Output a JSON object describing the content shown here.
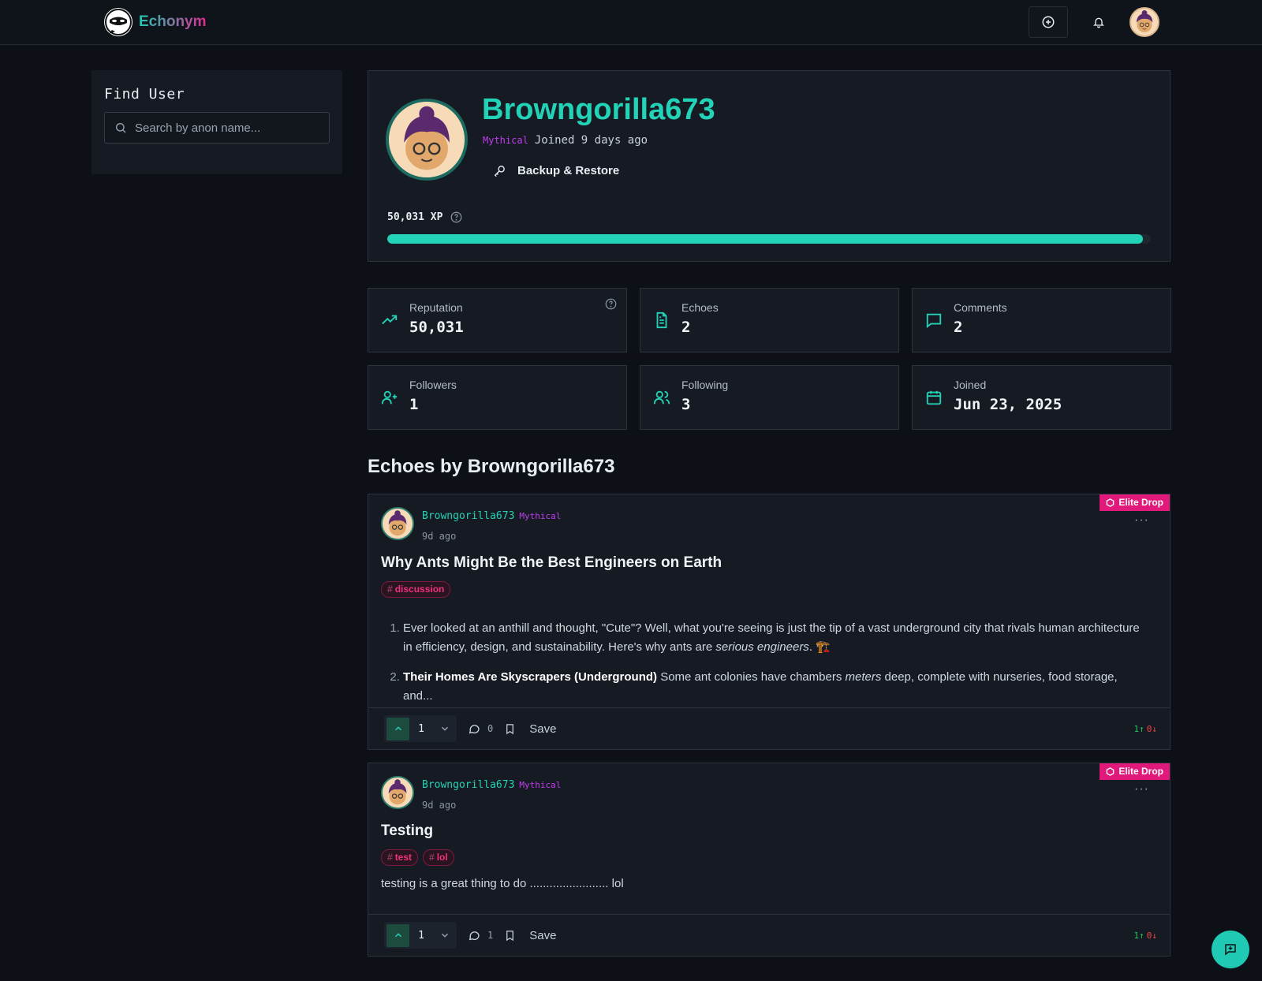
{
  "header": {
    "app_name": "Echonym",
    "icons": [
      "add-circle-icon",
      "bell-icon",
      "user-avatar"
    ]
  },
  "sidebar": {
    "title": "Find User",
    "search_placeholder": "Search by anon name..."
  },
  "profile": {
    "username": "Browngorilla673",
    "tier": "Mythical",
    "joined_text": "Joined 9 days ago",
    "backup_label": "Backup & Restore",
    "xp_label": "50,031 XP",
    "xp_progress_fraction": 0.99
  },
  "stats": [
    {
      "label": "Reputation",
      "value": "50,031",
      "icon": "trending-up-icon"
    },
    {
      "label": "Echoes",
      "value": "2",
      "icon": "document-icon"
    },
    {
      "label": "Comments",
      "value": "2",
      "icon": "message-icon"
    },
    {
      "label": "Followers",
      "value": "1",
      "icon": "user-plus-icon"
    },
    {
      "label": "Following",
      "value": "3",
      "icon": "users-icon"
    },
    {
      "label": "Joined",
      "value": "Jun 23, 2025",
      "icon": "calendar-icon"
    }
  ],
  "section_title": "Echoes by Browngorilla673",
  "posts": [
    {
      "badge": "Elite Drop",
      "author": "Browngorilla673",
      "tier": "Mythical",
      "time": "9d ago",
      "more": "···",
      "title": "Why Ants Might Be the Best Engineers on Earth",
      "tags": [
        "discussion"
      ],
      "body_items": [
        {
          "text_before": "Ever looked at an anthill and thought, \"Cute\"? Well, what you're seeing is just the tip of a vast underground city that rivals human architecture in efficiency, design, and sustainability. Here's why ants are ",
          "emph": "serious engineers",
          "text_after": ". 🏗️"
        },
        {
          "bold": "Their Homes Are Skyscrapers (Underground)",
          "text_before": " Some ant colonies have chambers ",
          "emph": "meters",
          "text_after": " deep, complete with nurseries, food storage, and..."
        }
      ],
      "votes": "1",
      "comments": "0",
      "save_label": "Save",
      "ratio_up": "1↑",
      "ratio_down": "0↓"
    },
    {
      "badge": "Elite Drop",
      "author": "Browngorilla673",
      "tier": "Mythical",
      "time": "9d ago",
      "more": "···",
      "title": "Testing",
      "tags": [
        "test",
        "lol"
      ],
      "body_text": "testing is a great thing to do ........................ lol",
      "votes": "1",
      "comments": "1",
      "save_label": "Save",
      "ratio_up": "1↑",
      "ratio_down": "0↓"
    }
  ],
  "colors": {
    "accent": "#22d3b8",
    "tier": "#c13df0",
    "elite": "#e0197a",
    "tag": "#f0307f"
  },
  "fab_icon": "chat-plus-icon"
}
